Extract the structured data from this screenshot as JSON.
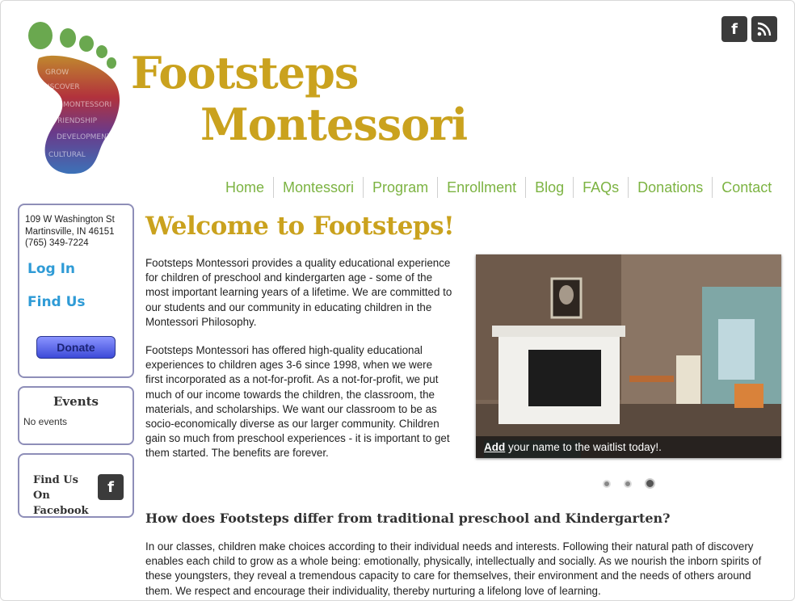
{
  "site": {
    "logo_line1": "Footsteps",
    "logo_line2": "Montessori"
  },
  "social": {
    "facebook_icon": "facebook-icon",
    "rss_icon": "rss-icon"
  },
  "nav": [
    {
      "label": "Home"
    },
    {
      "label": "Montessori"
    },
    {
      "label": "Program"
    },
    {
      "label": "Enrollment"
    },
    {
      "label": "Blog"
    },
    {
      "label": "FAQs"
    },
    {
      "label": "Donations"
    },
    {
      "label": "Contact"
    }
  ],
  "sidebar": {
    "address_line1": "109 W Washington St",
    "address_line2": "Martinsville, IN 46151",
    "phone": "(765) 349-7224",
    "login": "Log In",
    "find_us": "Find Us",
    "donate": "Donate",
    "events_title": "Events",
    "events_empty": "No events",
    "find_facebook": "Find Us On Facebook"
  },
  "main": {
    "welcome": "Welcome to Footsteps!",
    "para1": "Footsteps Montessori provides a quality educational experience for children of preschool and kindergarten age - some of the most important learning years of a lifetime.  We are committed to our students and our community in educating children in the Montessori Philosophy.",
    "para2": "Footsteps Montessori has offered high-quality educational experiences to children ages 3-6 since 1998, when we were first incorporated as a not-for-profit. As a not-for-profit, we put much of our income towards the children, the classroom, the materials, and scholarships. We want our classroom to be as socio-economically diverse as our larger community. Children gain so much from preschool experiences - it is important to get them started. The benefits are forever.",
    "slide_caption_link": "Add",
    "slide_caption_text": " your name to the waitlist today!.",
    "slide_active_index": 3,
    "slide_count": 3,
    "subhead": "How does Footsteps differ from traditional preschool and Kindergarten?",
    "para3": "In our classes, children make choices according to their individual needs and interests.  Following their natural path of discovery enables each child to grow as a whole being:  emotionally, physically, intellectually and socially. As we nourish the inborn spirits of these youngsters, they reveal a tremendous capacity to care for themselves, their environment and the needs of others around them.  We respect and encourage their individuality, thereby nurturing a lifelong love of learning."
  },
  "colors": {
    "brand_gold": "#caa21e",
    "nav_green": "#7cb342",
    "link_blue": "#2f9bd6",
    "box_border": "#8e8eb8"
  }
}
